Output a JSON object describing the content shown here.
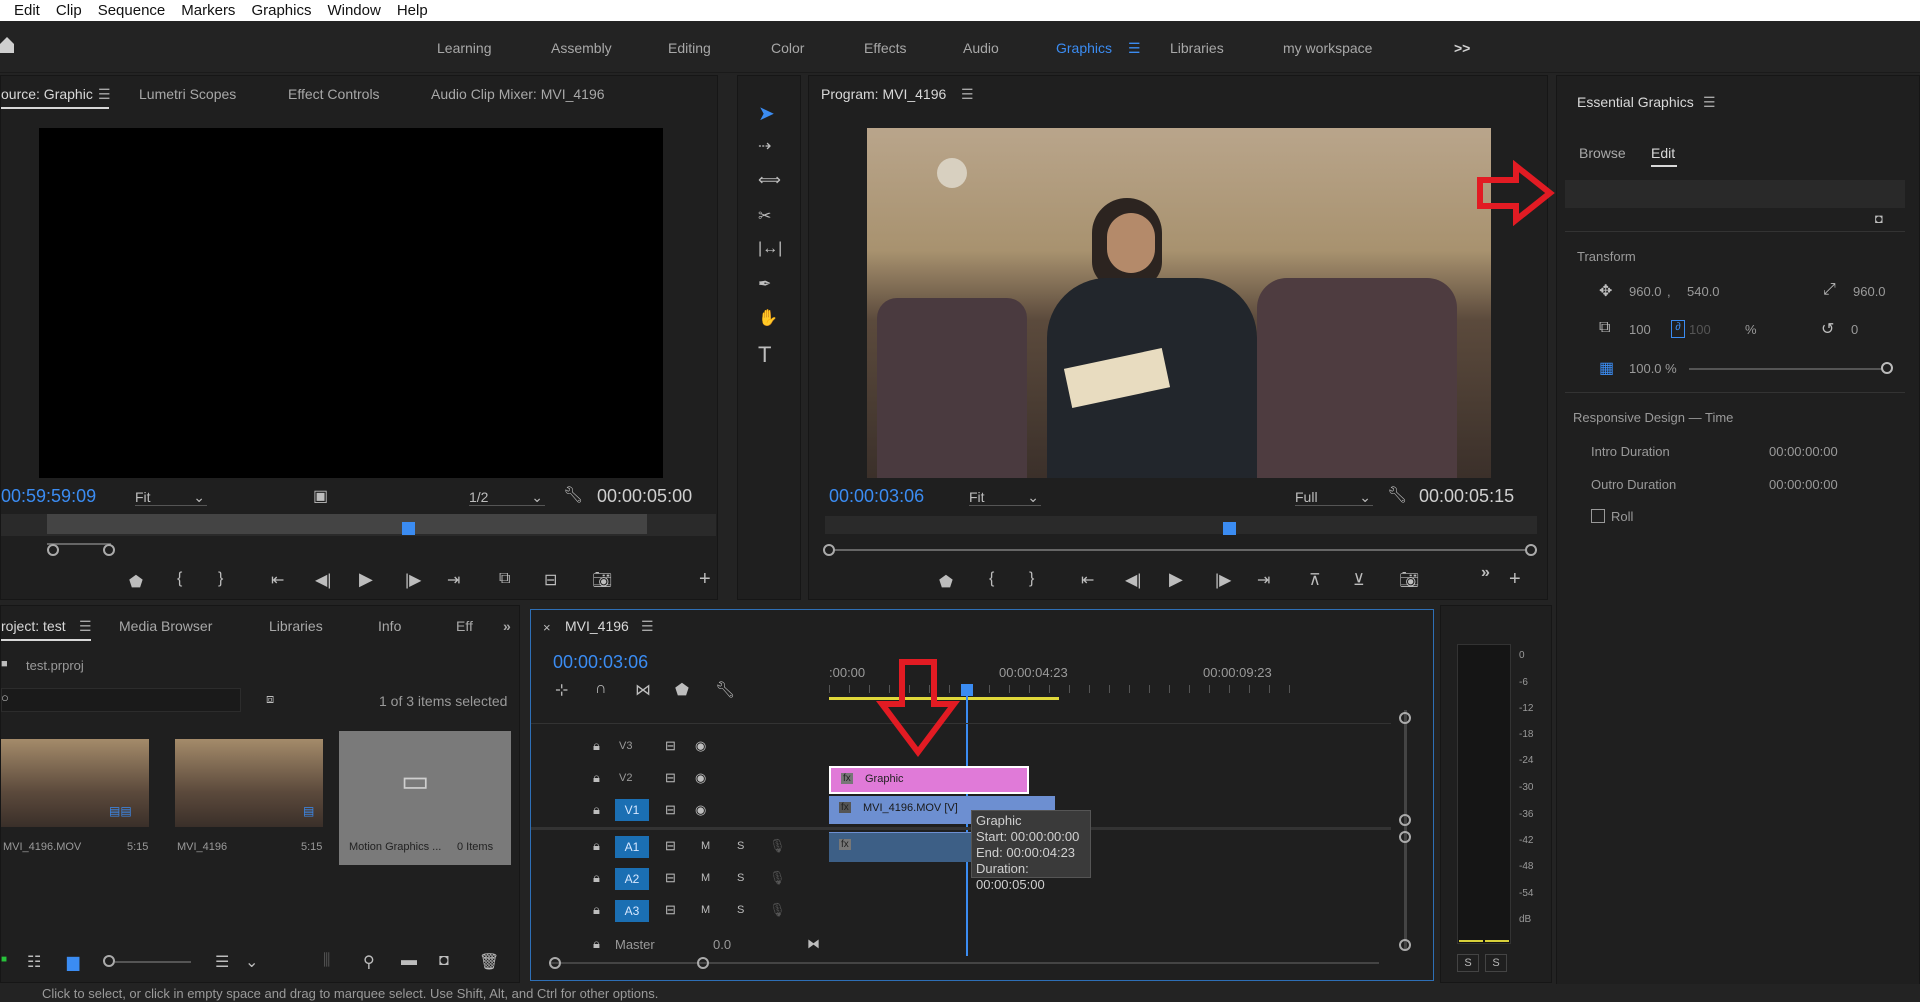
{
  "menu": [
    "Edit",
    "Clip",
    "Sequence",
    "Markers",
    "Graphics",
    "Window",
    "Help"
  ],
  "workspaces": {
    "items": [
      "Learning",
      "Assembly",
      "Editing",
      "Color",
      "Effects",
      "Audio",
      "Graphics",
      "Libraries",
      "my workspace"
    ],
    "active": "Graphics",
    "overflow": ">>"
  },
  "source": {
    "tabs": [
      "ource: Graphic",
      "Lumetri Scopes",
      "Effect Controls",
      "Audio Clip Mixer: MVI_4196"
    ],
    "timecode": "00:59:59:09",
    "fit": "Fit",
    "resolution": "1/2",
    "duration": "00:00:05:00"
  },
  "tools": [
    "selection",
    "track-select-forward",
    "ripple-edit",
    "razor",
    "slip",
    "pen",
    "hand",
    "type"
  ],
  "program": {
    "title": "Program: MVI_4196",
    "timecode": "00:00:03:06",
    "fit": "Fit",
    "quality": "Full",
    "duration": "00:00:05:15"
  },
  "essential": {
    "title": "Essential Graphics",
    "tabs": {
      "browse": "Browse",
      "edit": "Edit"
    },
    "transform_label": "Transform",
    "pos_x": "960.0",
    "pos_y": "540.0",
    "anchor": "960.0",
    "scale": "100",
    "scale_locked": "100",
    "percent": "%",
    "rotation": "0",
    "opacity": "100.0 %",
    "responsive": "Responsive Design — Time",
    "intro_label": "Intro Duration",
    "intro_value": "00:00:00:00",
    "outro_label": "Outro Duration",
    "outro_value": "00:00:00:00",
    "roll": "Roll"
  },
  "project": {
    "tabs": [
      "roject: test",
      "Media Browser",
      "Libraries",
      "Info",
      "Eff"
    ],
    "file": "test.prproj",
    "selected": "1 of 3 items selected",
    "items": [
      {
        "name": "MVI_4196.MOV",
        "dur": "5:15"
      },
      {
        "name": "MVI_4196",
        "dur": "5:15"
      },
      {
        "name": "Motion Graphics ...",
        "dur": "0 Items"
      }
    ]
  },
  "timeline": {
    "title": "MVI_4196",
    "timecode": "00:00:03:06",
    "ruler": [
      ":00:00",
      "00:00:04:23",
      "00:00:09:23"
    ],
    "tracks_v": [
      "V3",
      "V2",
      "V1"
    ],
    "tracks_a": [
      "A1",
      "A2",
      "A3"
    ],
    "m": "M",
    "s": "S",
    "master": "Master",
    "master_val": "0.0",
    "clip_graphic": "Graphic",
    "clip_video": "MVI_4196.MOV [V]",
    "tooltip": {
      "title": "Graphic",
      "start": "Start: 00:00:00:00",
      "end": "End: 00:00:04:23",
      "duration": "Duration: 00:00:05:00"
    }
  },
  "meter": {
    "scale": [
      "0",
      "-6",
      "-12",
      "-18",
      "-24",
      "-30",
      "-36",
      "-42",
      "-48",
      "-54",
      "dB"
    ],
    "solo": [
      "S",
      "S"
    ]
  },
  "status": "Click to select, or click in empty space and drag to marquee select. Use Shift, Alt, and Ctrl for other options.",
  "colors": {
    "accent": "#3b8cf2",
    "annotation": "#e21b23",
    "graphic_clip": "#e07ad8",
    "video_clip": "#6d8fd1"
  }
}
